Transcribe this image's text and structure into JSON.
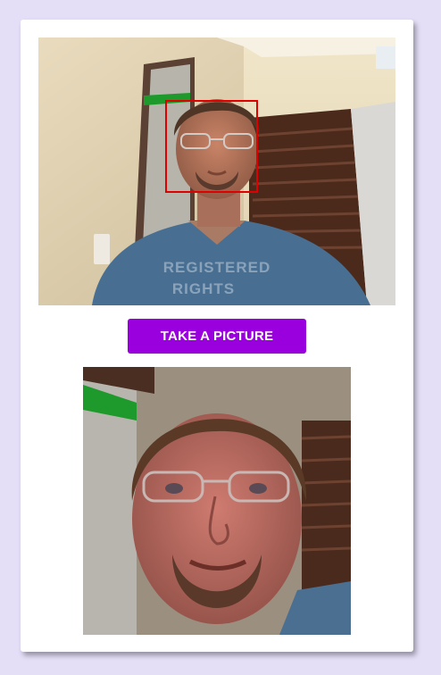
{
  "camera": {
    "face_detected": true,
    "face_box_color": "#e00000",
    "shirt_print_line1": "REGISTERED",
    "shirt_print_line2": "RIGHTS"
  },
  "controls": {
    "take_picture_label": "TAKE A PICTURE",
    "button_color": "#9a00dd"
  },
  "colors": {
    "page_background": "#e4def7",
    "card_background": "#ffffff"
  }
}
